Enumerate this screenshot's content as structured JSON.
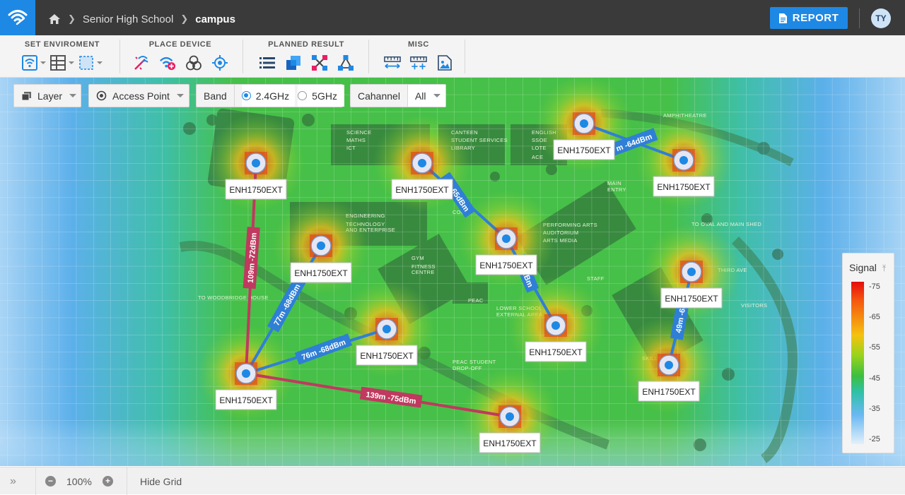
{
  "header": {
    "breadcrumb": [
      "Senior High School",
      "campus"
    ],
    "report_label": "REPORT",
    "user_initials": "TY"
  },
  "toolbar": {
    "groups": [
      {
        "title": "SET ENVIROMENT",
        "icons": [
          "wifi-settings-icon",
          "wall-grid-icon",
          "area-select-icon"
        ]
      },
      {
        "title": "PLACE DEVICE",
        "icons": [
          "magic-wand-icon",
          "add-ap-icon",
          "three-circles-icon",
          "crosshair-icon"
        ]
      },
      {
        "title": "PLANNED RESULT",
        "icons": [
          "list-icon",
          "coverage-icon",
          "channel-icon",
          "topology-icon"
        ]
      },
      {
        "title": "MISC",
        "icons": [
          "ruler-icon",
          "measure-add-icon",
          "image-icon"
        ]
      }
    ]
  },
  "controls": {
    "layer": "Layer",
    "device_type": "Access Point",
    "band_label": "Band",
    "band_options": [
      "2.4GHz",
      "5GHz"
    ],
    "band_selected": "2.4GHz",
    "channel_label": "Cahannel",
    "channel_value": "All"
  },
  "legend": {
    "title": "Signal",
    "ticks": [
      "-75",
      "-65",
      "-55",
      "-45",
      "-35",
      "-25"
    ]
  },
  "access_points": [
    {
      "label": "ENH1750EXT"
    },
    {
      "label": "ENH1750EXT"
    },
    {
      "label": "ENH1750EXT"
    },
    {
      "label": "ENH1750EXT"
    },
    {
      "label": "ENH1750EXT"
    },
    {
      "label": "ENH1750EXT"
    },
    {
      "label": "ENH1750EXT"
    },
    {
      "label": "ENH1750EXT"
    },
    {
      "label": "ENH1750EXT"
    },
    {
      "label": "ENH1750EXT"
    },
    {
      "label": "ENH1750EXT"
    },
    {
      "label": "ENH1750EXT"
    },
    {
      "label": "ENH1750EXT"
    }
  ],
  "links": [
    {
      "label": "109m -72dBm",
      "color": "#c0395f"
    },
    {
      "label": "77m -68dBm",
      "color": "#2f7fd6"
    },
    {
      "label": "76m -68dBm",
      "color": "#2f7fd6"
    },
    {
      "label": "139m -75dBm",
      "color": "#c0395f"
    },
    {
      "label": "m -65dBm",
      "color": "#2f7fd6"
    },
    {
      "label": "-63dBm",
      "color": "#2f7fd6"
    },
    {
      "label": "m -64dBm",
      "color": "#2f7fd6"
    },
    {
      "label": "49m -63",
      "color": "#2f7fd6"
    }
  ],
  "map_labels": [
    "SCIENCE",
    "MATHS",
    "ICT",
    "CANTEEN",
    "STUDENT SERVICES",
    "LIBRARY",
    "ENGLISH",
    "SSOE",
    "LOTE",
    "ACE",
    "ENGINEERING",
    "TECHNOLOGY",
    "AND ENTERPRISE",
    "GYM",
    "FITNESS",
    "CENTRE",
    "PERFORMING ARTS",
    "AUDITORIUM",
    "ARTS MEDIA",
    "MAIN",
    "ENTRY",
    "PEAC",
    "LOWER SCHOOL",
    "EXTERNAL AREA",
    "TO WOODBRIDGE HOUSE",
    "COURT",
    "STAFF",
    "AMPHITHEATRE",
    "TO OVAL AND MAIN SHED",
    "VISITORS",
    "PEAC STUDENT",
    "DROP-OFF",
    "SKILLS",
    "THIRD AVE"
  ],
  "bottom": {
    "zoom": "100%",
    "grid_toggle": "Hide Grid"
  }
}
